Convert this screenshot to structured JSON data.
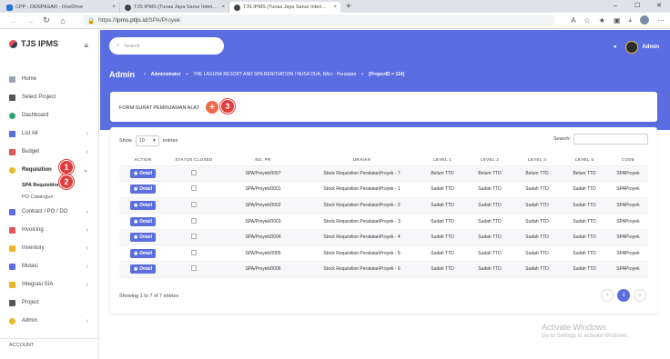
{
  "browser": {
    "tabs": [
      {
        "label": "CPP - DENPASAR - OneDrive",
        "color": "#2f6fd3"
      },
      {
        "label": "TJS IPMS (Tunas Jaya Sanur Interi...",
        "color": "#444444"
      },
      {
        "label": "TJS IPMS (Tunas Jaya Sanur Interi...",
        "color": "#444444"
      }
    ],
    "new_tab": "+",
    "url_prefix": "https://",
    "url_host": "ipms.ptljs.id",
    "url_path": "/SPA/Proyek"
  },
  "sidebar": {
    "brand": "TJS IPMS",
    "items": [
      {
        "label": "Home",
        "icon": "home-icon",
        "color": "#9aa3b5",
        "chev": ""
      },
      {
        "label": "Select Project",
        "icon": "select-project-icon",
        "color": "#555555",
        "chev": ""
      },
      {
        "label": "Dashboard",
        "icon": "dashboard-icon",
        "color": "#2ea36a",
        "chev": ""
      },
      {
        "label": "List All",
        "icon": "list-icon",
        "color": "#5b6ee1",
        "chev": "›"
      },
      {
        "label": "Budget",
        "icon": "budget-icon",
        "color": "#e45757",
        "chev": "›"
      },
      {
        "label": "Requisition",
        "icon": "requisition-icon",
        "color": "#f0b429",
        "chev": "⌄"
      }
    ],
    "submenu": [
      "SPA Requisition",
      "PO Catalogue"
    ],
    "items2": [
      {
        "label": "Contract / PO / DO",
        "icon": "contract-icon",
        "color": "#5b6ee1",
        "chev": "›"
      },
      {
        "label": "Invoicing",
        "icon": "invoicing-icon",
        "color": "#e45757",
        "chev": "›"
      },
      {
        "label": "Inventory",
        "icon": "inventory-icon",
        "color": "#f0b429",
        "chev": "›"
      },
      {
        "label": "Mutasi",
        "icon": "mutasi-icon",
        "color": "#5b6ee1",
        "chev": "›"
      },
      {
        "label": "Integrasi SIA",
        "icon": "integrasi-icon",
        "color": "#f0b429",
        "chev": "›"
      },
      {
        "label": "Project",
        "icon": "project-icon",
        "color": "#555555",
        "chev": ""
      },
      {
        "label": "Admin",
        "icon": "admin-icon",
        "color": "#f0b429",
        "chev": "›"
      }
    ],
    "account": "ACCOUNT"
  },
  "badges": {
    "one": "1",
    "two": "2",
    "three": "3"
  },
  "header": {
    "search_placeholder": "Search",
    "user": "Admin",
    "title": "Admin",
    "crumb1": "Administrator",
    "crumb2": "THE LAGUNA RESORT AND SPA RENOVATION I NUSA DUA, BALI - Peralatan",
    "crumb3": "[ProjectID = 114]"
  },
  "form": {
    "title": "FORM SURAT PEMINJAMAN ALAT",
    "add": "+"
  },
  "table": {
    "show": "Show",
    "entries_value": "10",
    "entries": "entries",
    "search": "Search:",
    "columns": [
      "ACTION",
      "STATUS CLOSED",
      "NO. PR",
      "URAIAN",
      "LEVEL 1",
      "LEVEL 2",
      "LEVEL 3",
      "LEVEL 4",
      "CODE"
    ],
    "detail_label": "Detail",
    "rows": [
      {
        "no": "SPA/Proyek/0007",
        "uraian": "Stock Requisition PeralatanProyek - 7",
        "l1": "Belum TTD",
        "l2": "Belum TTD",
        "l3": "Belum TTD",
        "l4": "Belum TTD",
        "code": "SPAProyek"
      },
      {
        "no": "SPA/Proyek/0001",
        "uraian": "Stock Requisition PeralatanProyek - 1",
        "l1": "Sudah TTD",
        "l2": "Sudah TTD",
        "l3": "Sudah TTD",
        "l4": "Sudah TTD",
        "code": "SPAProyek"
      },
      {
        "no": "SPA/Proyek/0002",
        "uraian": "Stock Requisition PeralatanProyek - 2",
        "l1": "Sudah TTD",
        "l2": "Sudah TTD",
        "l3": "Sudah TTD",
        "l4": "Sudah TTD",
        "code": "SPAProyek"
      },
      {
        "no": "SPA/Proyek/0003",
        "uraian": "Stock Requisition PeralatanProyek - 3",
        "l1": "Sudah TTD",
        "l2": "Sudah TTD",
        "l3": "Sudah TTD",
        "l4": "Sudah TTD",
        "code": "SPAProyek"
      },
      {
        "no": "SPA/Proyek/0004",
        "uraian": "Stock Requisition PeralatanProyek - 4",
        "l1": "Sudah TTD",
        "l2": "Sudah TTD",
        "l3": "Sudah TTD",
        "l4": "Sudah TTD",
        "code": "SPAProyek"
      },
      {
        "no": "SPA/Proyek/0005",
        "uraian": "Stock Requisition PeralatanProyek - 5",
        "l1": "Sudah TTD",
        "l2": "Sudah TTD",
        "l3": "Sudah TTD",
        "l4": "Sudah TTD",
        "code": "SPAProyek"
      },
      {
        "no": "SPA/Proyek/0006",
        "uraian": "Stock Requisition PeralatanProyek - 6",
        "l1": "Sudah TTD",
        "l2": "Sudah TTD",
        "l3": "Sudah TTD",
        "l4": "Sudah TTD",
        "code": "SPAProyek"
      }
    ],
    "info": "Showing 1 to 7 of 7 entries",
    "page": "1",
    "prev": "‹",
    "next": "›"
  },
  "watermark": {
    "line1": "Activate Windows",
    "line2": "Go to Settings to activate Windows."
  }
}
